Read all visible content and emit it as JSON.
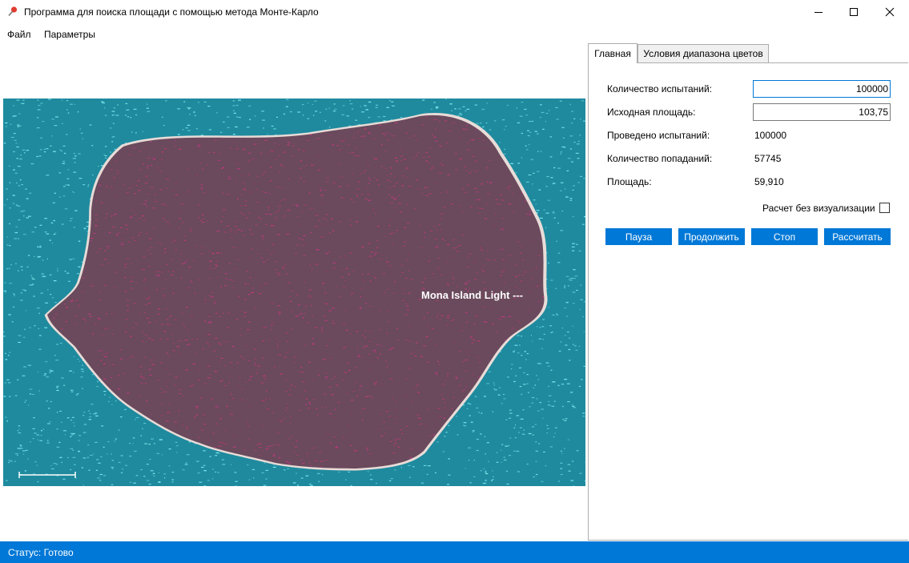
{
  "window": {
    "title": "Программа для поиска площади с помощью метода Монте-Карло"
  },
  "menu": {
    "items": [
      "Файл",
      "Параметры"
    ]
  },
  "image": {
    "overlay_label": "Mona Island Light ---"
  },
  "tabs": {
    "items": [
      {
        "label": "Главная",
        "active": true
      },
      {
        "label": "Условия диапазона цветов",
        "active": false
      }
    ]
  },
  "main": {
    "trials_label": "Количество испытаний:",
    "trials_value": "100000",
    "area_label": "Исходная площадь:",
    "area_value": "103,75",
    "done_label": "Проведено испытаний:",
    "done_value": "100000",
    "hits_label": "Количество попаданий:",
    "hits_value": "57745",
    "result_label": "Площадь:",
    "result_value": "59,910",
    "no_visual_label": "Расчет без визуализации",
    "no_visual_checked": false,
    "buttons": {
      "pause": "Пауза",
      "resume": "Продолжить",
      "stop": "Стоп",
      "compute": "Рассчитать"
    }
  },
  "status": {
    "text": "Статус: Готово"
  },
  "colors": {
    "accent": "#0078d7",
    "sea": "#1f8a9e",
    "sea_dots": "#7ff0f5",
    "island": "#6a4a5c",
    "island_dots": "#c0397f"
  }
}
